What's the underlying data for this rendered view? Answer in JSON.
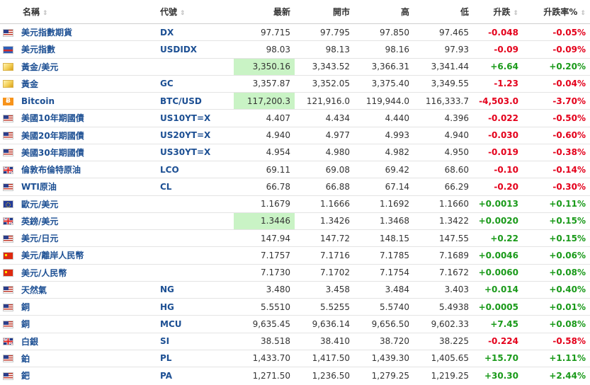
{
  "headers": {
    "name": "名稱",
    "code": "代號",
    "last": "最新",
    "open": "開市",
    "high": "高",
    "low": "低",
    "change": "升跌",
    "change_pct": "升跌率%"
  },
  "sort_glyph": "⇕",
  "rows": [
    {
      "flag": "us-flag-icon",
      "name": "美元指數期貨",
      "code": "DX",
      "last": "97.715",
      "open": "97.795",
      "high": "97.850",
      "low": "97.465",
      "change": "-0.048",
      "change_pct": "-0.05%",
      "dir": "down",
      "highlight": false
    },
    {
      "flag": "usdidx-flag-icon",
      "name": "美元指數",
      "code": "USDIDX",
      "last": "98.03",
      "open": "98.13",
      "high": "98.16",
      "low": "97.93",
      "change": "-0.09",
      "change_pct": "-0.09%",
      "dir": "down",
      "highlight": false
    },
    {
      "flag": "gold-icon",
      "name": "黃金/美元",
      "code": "",
      "last": "3,350.16",
      "open": "3,343.52",
      "high": "3,366.31",
      "low": "3,341.44",
      "change": "+6.64",
      "change_pct": "+0.20%",
      "dir": "up",
      "highlight": true
    },
    {
      "flag": "gold-icon",
      "name": "黃金",
      "code": "GC",
      "last": "3,357.87",
      "open": "3,352.05",
      "high": "3,375.40",
      "low": "3,349.55",
      "change": "-1.23",
      "change_pct": "-0.04%",
      "dir": "down",
      "highlight": false
    },
    {
      "flag": "bitcoin-icon",
      "name": "Bitcoin",
      "code": "BTC/USD",
      "last": "117,200.3",
      "open": "121,916.0",
      "high": "119,944.0",
      "low": "116,333.7",
      "change": "-4,503.0",
      "change_pct": "-3.70%",
      "dir": "down",
      "highlight": true
    },
    {
      "flag": "us-flag-icon",
      "name": "美國10年期國債",
      "code": "US10YT=X",
      "last": "4.407",
      "open": "4.434",
      "high": "4.440",
      "low": "4.396",
      "change": "-0.022",
      "change_pct": "-0.50%",
      "dir": "down",
      "highlight": false
    },
    {
      "flag": "us-flag-icon",
      "name": "美國20年期國債",
      "code": "US20YT=X",
      "last": "4.940",
      "open": "4.977",
      "high": "4.993",
      "low": "4.940",
      "change": "-0.030",
      "change_pct": "-0.60%",
      "dir": "down",
      "highlight": false
    },
    {
      "flag": "us-flag-icon",
      "name": "美國30年期國債",
      "code": "US30YT=X",
      "last": "4.954",
      "open": "4.980",
      "high": "4.982",
      "low": "4.950",
      "change": "-0.019",
      "change_pct": "-0.38%",
      "dir": "down",
      "highlight": false
    },
    {
      "flag": "uk-flag-icon",
      "name": "倫敦布倫特原油",
      "code": "LCO",
      "last": "69.11",
      "open": "69.08",
      "high": "69.42",
      "low": "68.60",
      "change": "-0.10",
      "change_pct": "-0.14%",
      "dir": "down",
      "highlight": false
    },
    {
      "flag": "us-flag-icon",
      "name": "WTI原油",
      "code": "CL",
      "last": "66.78",
      "open": "66.88",
      "high": "67.14",
      "low": "66.29",
      "change": "-0.20",
      "change_pct": "-0.30%",
      "dir": "down",
      "highlight": false
    },
    {
      "flag": "eu-flag-icon",
      "name": "歐元/美元",
      "code": "",
      "last": "1.1679",
      "open": "1.1666",
      "high": "1.1692",
      "low": "1.1660",
      "change": "+0.0013",
      "change_pct": "+0.11%",
      "dir": "up",
      "highlight": false
    },
    {
      "flag": "uk-flag-icon",
      "name": "英鎊/美元",
      "code": "",
      "last": "1.3446",
      "open": "1.3426",
      "high": "1.3468",
      "low": "1.3422",
      "change": "+0.0020",
      "change_pct": "+0.15%",
      "dir": "up",
      "highlight": true
    },
    {
      "flag": "us-flag-icon",
      "name": "美元/日元",
      "code": "",
      "last": "147.94",
      "open": "147.72",
      "high": "148.15",
      "low": "147.55",
      "change": "+0.22",
      "change_pct": "+0.15%",
      "dir": "up",
      "highlight": false
    },
    {
      "flag": "cn-flag-icon",
      "name": "美元/離岸人民幣",
      "code": "",
      "last": "7.1757",
      "open": "7.1716",
      "high": "7.1785",
      "low": "7.1689",
      "change": "+0.0046",
      "change_pct": "+0.06%",
      "dir": "up",
      "highlight": false
    },
    {
      "flag": "cn-flag-icon",
      "name": "美元/人民幣",
      "code": "",
      "last": "7.1730",
      "open": "7.1702",
      "high": "7.1754",
      "low": "7.1672",
      "change": "+0.0060",
      "change_pct": "+0.08%",
      "dir": "up",
      "highlight": false
    },
    {
      "flag": "us-flag-icon",
      "name": "天然氣",
      "code": "NG",
      "last": "3.480",
      "open": "3.458",
      "high": "3.484",
      "low": "3.403",
      "change": "+0.014",
      "change_pct": "+0.40%",
      "dir": "up",
      "highlight": false
    },
    {
      "flag": "us-flag-icon",
      "name": "銅",
      "code": "HG",
      "last": "5.5510",
      "open": "5.5255",
      "high": "5.5740",
      "low": "5.4938",
      "change": "+0.0005",
      "change_pct": "+0.01%",
      "dir": "up",
      "highlight": false
    },
    {
      "flag": "us-flag-icon",
      "name": "銅",
      "code": "MCU",
      "last": "9,635.45",
      "open": "9,636.14",
      "high": "9,656.50",
      "low": "9,602.33",
      "change": "+7.45",
      "change_pct": "+0.08%",
      "dir": "up",
      "highlight": false
    },
    {
      "flag": "uk-flag-icon",
      "name": "白銀",
      "code": "SI",
      "last": "38.518",
      "open": "38.410",
      "high": "38.720",
      "low": "38.225",
      "change": "-0.224",
      "change_pct": "-0.58%",
      "dir": "down",
      "highlight": false
    },
    {
      "flag": "us-flag-icon",
      "name": "鉑",
      "code": "PL",
      "last": "1,433.70",
      "open": "1,417.50",
      "high": "1,439.30",
      "low": "1,405.65",
      "change": "+15.70",
      "change_pct": "+1.11%",
      "dir": "up",
      "highlight": false
    },
    {
      "flag": "us-flag-icon",
      "name": "鈀",
      "code": "PA",
      "last": "1,271.50",
      "open": "1,236.50",
      "high": "1,279.25",
      "low": "1,219.25",
      "change": "+30.30",
      "change_pct": "+2.44%",
      "dir": "up",
      "highlight": false
    }
  ]
}
